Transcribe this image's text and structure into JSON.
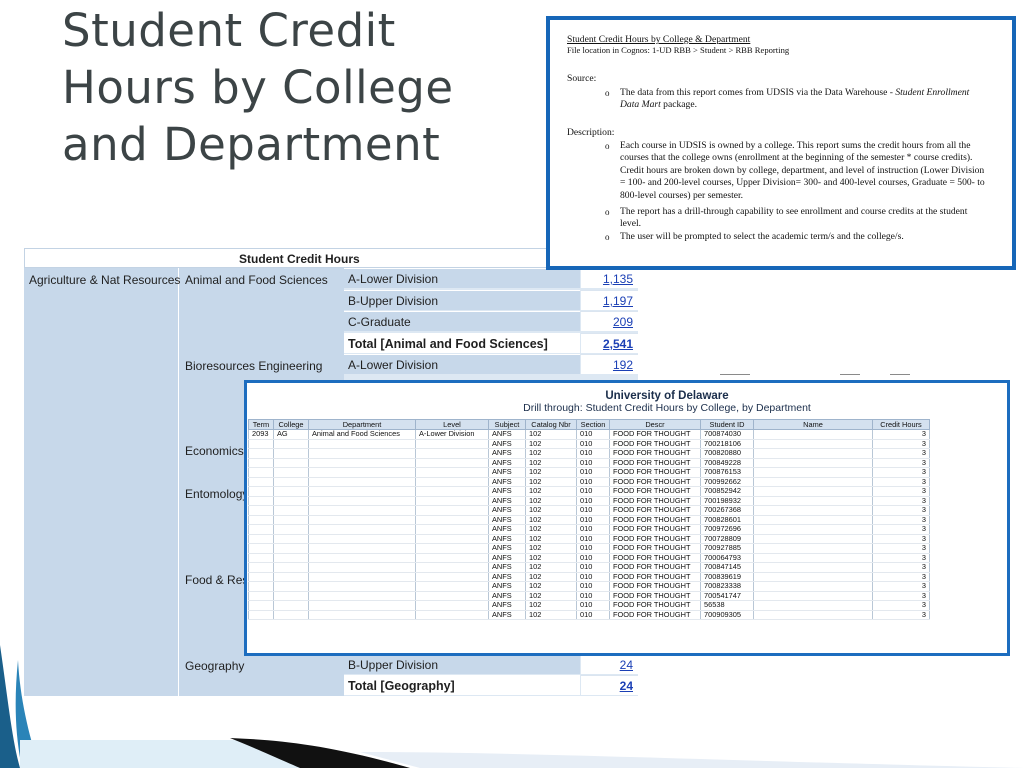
{
  "slide_title": "Student Credit Hours by College and Department",
  "report": {
    "header": "Student Credit Hours",
    "college": "Agriculture & Nat Resources",
    "departments": [
      "Animal and Food Sciences",
      "Bioresources Engineering",
      "Economics",
      "Entomology",
      "Food & Res",
      "Geography"
    ],
    "levels": [
      "A-Lower Division",
      "B-Upper Division",
      "C-Graduate",
      "Total [Animal and Food Sciences]",
      "A-Lower Division",
      "B-Upper Division",
      "Total [Geography]"
    ],
    "values": [
      "1,135",
      "1,197",
      "209",
      "2,541",
      "192",
      "24",
      "24"
    ]
  },
  "info": {
    "title": "Student Credit Hours by College & Department",
    "file_location": "File location in Cognos: 1-UD RBB > Student > RBB Reporting",
    "source_label": "Source:",
    "bullet": "o",
    "source_text_a": "The data from this report comes from UDSIS via the Data Warehouse - ",
    "source_text_b": "Student Enrollment Data Mart",
    "source_text_c": " package.",
    "description_label": "Description:",
    "desc_1": "Each course in UDSIS is owned by a college.  This report sums the credit hours from all the courses that the college owns (enrollment at the beginning of the semester * course credits).  Credit hours are broken down by college, department, and level of instruction (Lower Division = 100- and 200-level courses, Upper Division= 300- and 400-level courses, Graduate = 500- to 800-level courses) per semester.",
    "desc_2": "The report has a drill-through capability to see enrollment and course credits at the student level.",
    "desc_3": "The user will be prompted to select the academic term/s and the college/s."
  },
  "drill": {
    "university": "University of Delaware",
    "subtitle": "Drill through: Student Credit Hours by College, by Department",
    "columns": [
      "Term",
      "College",
      "Department",
      "Level",
      "Subject",
      "Catalog Nbr",
      "Section",
      "Descr",
      "Student ID",
      "Name",
      "Credit Hours"
    ],
    "first_row": {
      "term": "2093",
      "college": "AG",
      "department": "Animal and Food Sciences",
      "level": "A-Lower Division"
    },
    "subject": "ANFS",
    "catalog": "102",
    "section": "010",
    "descr": "FOOD FOR THOUGHT",
    "credit": "3",
    "student_ids": [
      "700874030",
      "700218106",
      "700820880",
      "700849228",
      "700876153",
      "700992662",
      "700852942",
      "700198932",
      "700267368",
      "700828601",
      "700972696",
      "700728809",
      "700927885",
      "700064793",
      "700847145",
      "700839619",
      "700823338",
      "700541747",
      "56538",
      "700909305"
    ]
  }
}
